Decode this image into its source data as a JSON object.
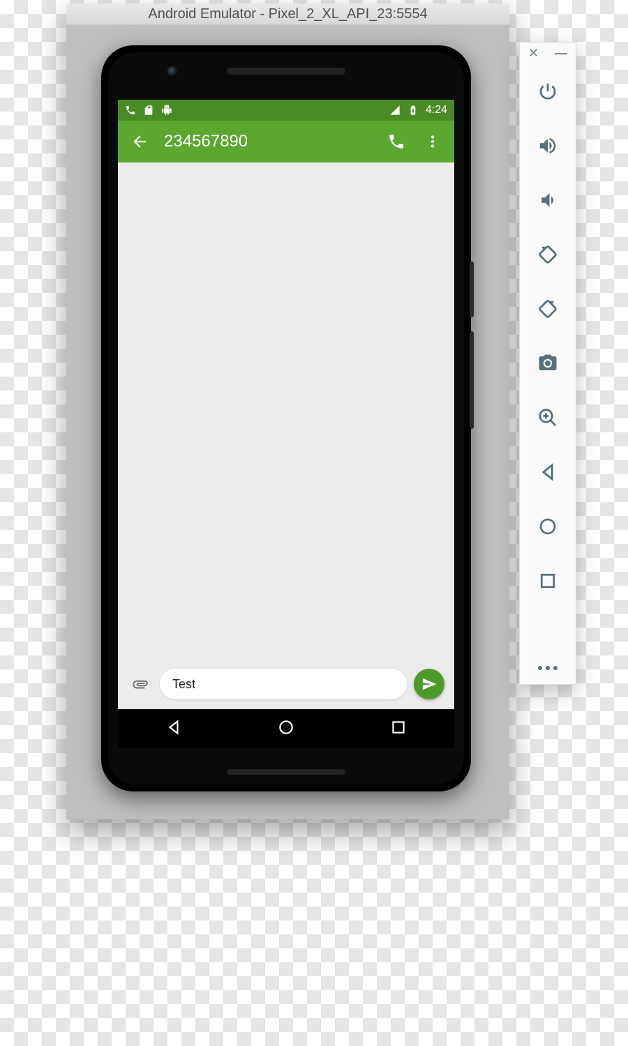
{
  "emulator": {
    "title": "Android Emulator - Pixel_2_XL_API_23:5554",
    "toolbar": {
      "close_icon": "close",
      "minimize_icon": "minimize",
      "buttons": [
        {
          "name": "power-icon"
        },
        {
          "name": "volume-up-icon"
        },
        {
          "name": "volume-down-icon"
        },
        {
          "name": "rotate-left-icon"
        },
        {
          "name": "rotate-right-icon"
        },
        {
          "name": "camera-icon"
        },
        {
          "name": "zoom-in-icon"
        },
        {
          "name": "back-icon"
        },
        {
          "name": "home-icon"
        },
        {
          "name": "overview-icon"
        }
      ],
      "more_icon": "more"
    }
  },
  "statusbar": {
    "left_icons": [
      "phone-icon",
      "sd-card-icon",
      "android-icon"
    ],
    "right_icons": [
      "signal-icon",
      "battery-icon"
    ],
    "time": "4:24"
  },
  "appbar": {
    "back_icon": "arrow-back",
    "title": "234567890",
    "call_icon": "phone",
    "overflow_icon": "more-vert"
  },
  "composer": {
    "attach_icon": "attachment",
    "input_value": "Test",
    "send_icon": "send"
  },
  "navbar": {
    "back_icon": "nav-back",
    "home_icon": "nav-home",
    "recent_icon": "nav-recent"
  }
}
